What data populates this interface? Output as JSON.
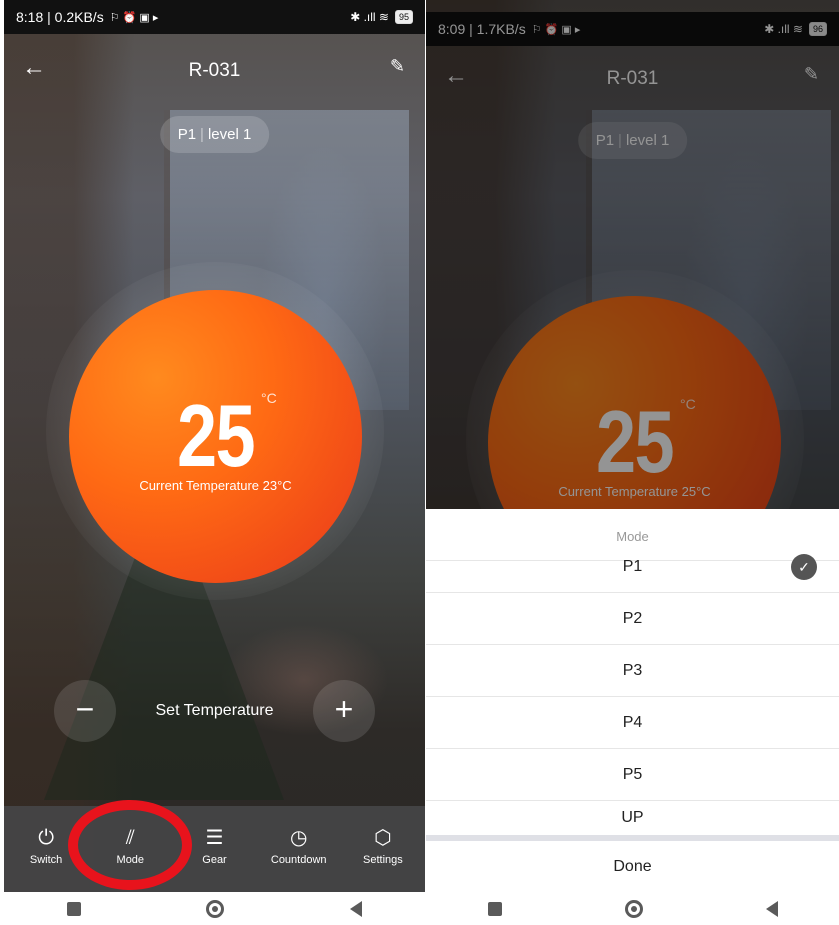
{
  "left": {
    "status": {
      "time_speed": "8:18 | 0.2KB/s",
      "icons": "⚐ ⏰ ▣ ▸",
      "signal": "✱ .ıll ≋",
      "battery": "95"
    },
    "header": {
      "back_icon": "←",
      "title": "R-031",
      "edit_icon": "✎"
    },
    "mode_pill": {
      "mode": "P1",
      "level": "level 1"
    },
    "dial": {
      "set_value": "25",
      "unit": "°C",
      "current": "Current Temperature 23°C",
      "color": "#ff6a14"
    },
    "controls": {
      "minus": "−",
      "label": "Set Temperature",
      "plus": "+"
    },
    "tabs": [
      {
        "icon": "⏻",
        "label": "Switch"
      },
      {
        "icon": "⫽",
        "label": "Mode"
      },
      {
        "icon": "☰",
        "label": "Gear"
      },
      {
        "icon": "◷",
        "label": "Countdown"
      },
      {
        "icon": "⬡",
        "label": "Settings"
      }
    ],
    "highlight_color": "#e8131c"
  },
  "right": {
    "status": {
      "time_speed": "8:09 | 1.7KB/s",
      "icons": "⚐ ⏰ ▣ ▸",
      "signal": "✱ .ıll ≋",
      "battery": "96"
    },
    "header": {
      "back_icon": "←",
      "title": "R-031",
      "edit_icon": "✎"
    },
    "mode_pill": {
      "mode": "P1",
      "level": "level 1"
    },
    "dial": {
      "set_value": "25",
      "unit": "°C",
      "current": "Current Temperature 25°C"
    },
    "sheet": {
      "title": "Mode",
      "options": [
        "P1",
        "P2",
        "P3",
        "P4",
        "P5",
        "UP"
      ],
      "selected": "P1",
      "check_icon": "✓",
      "done": "Done"
    }
  }
}
